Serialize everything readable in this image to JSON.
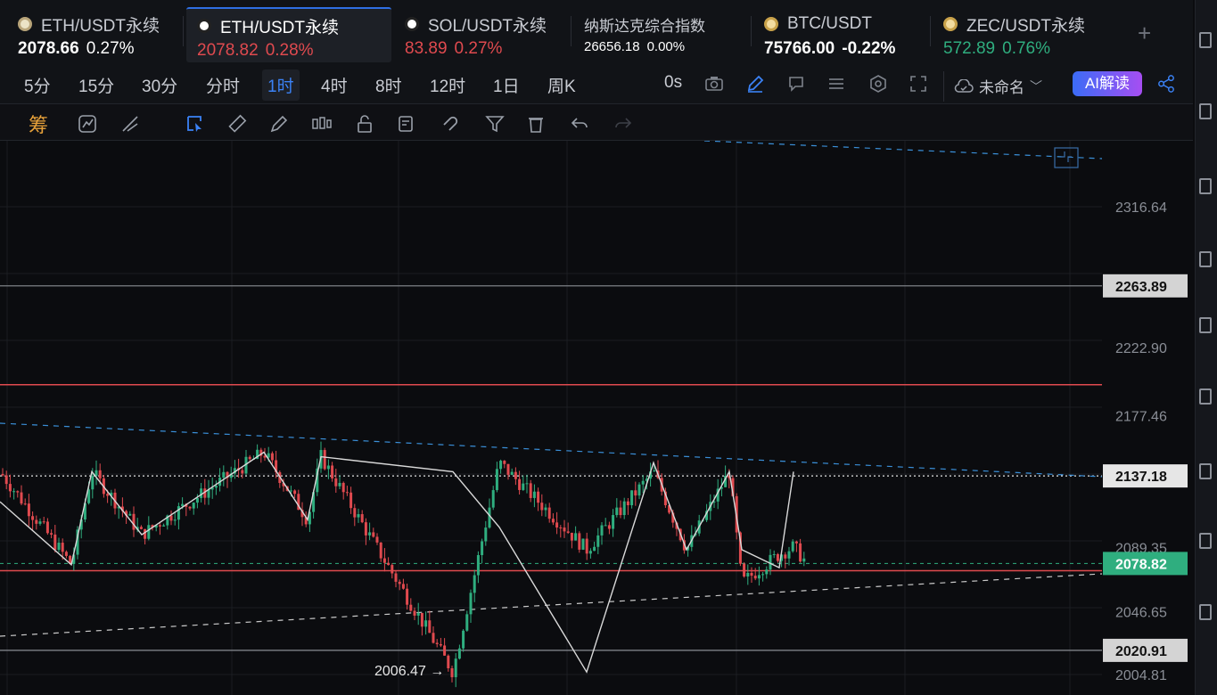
{
  "tabs": [
    {
      "name": "ETH/USDT永续",
      "price": "2078.66",
      "change": "0.27%",
      "dir": "plain",
      "icon": "eth-coin-icon"
    },
    {
      "name": "ETH/USDT永续",
      "price": "2078.82",
      "change": "0.28%",
      "dir": "up",
      "icon": "okx-logo-icon"
    },
    {
      "name": "SOL/USDT永续",
      "price": "83.89",
      "change": "0.27%",
      "dir": "up",
      "icon": "okx-logo-icon"
    },
    {
      "name": "纳斯达克综合指数",
      "price": "26656.18",
      "change": "0.00%",
      "dir": "plain",
      "icon": ""
    },
    {
      "name": "BTC/USDT",
      "price": "75766.00",
      "change": "-0.22%",
      "dir": "plain",
      "icon": "bnb-coin-icon"
    },
    {
      "name": "ZEC/USDT永续",
      "price": "572.89",
      "change": "0.76%",
      "dir": "down",
      "icon": "bnb-coin-icon"
    }
  ],
  "add_tab": "+",
  "timeframes": [
    "5分",
    "15分",
    "30分",
    "分时",
    "1时",
    "4时",
    "8时",
    "12时",
    "1日",
    "周K"
  ],
  "active_timeframe": "1时",
  "countdown": "0s",
  "layout_name": "未命名",
  "ai_button": "AI解读",
  "indicator_label": "筹",
  "price_axis": {
    "ticks": [
      "2316.64",
      "2222.90",
      "2177.46",
      "2089.35",
      "2046.65",
      "2004.81"
    ],
    "tags": {
      "line_2263": "2263.89",
      "line_2137": "2137.18",
      "current": "2078.82",
      "line_2020": "2020.91"
    }
  },
  "low_annotation": "2006.47 →",
  "colors": {
    "up": "#e04a4f",
    "down": "#2fae7f",
    "accent": "#3b82f6",
    "horizontal_red": "#e04a4f",
    "trend_dash": "#3a8fd8",
    "zigzag": "#d9d9d9"
  },
  "chart_data": {
    "type": "line",
    "title": "",
    "y_ticks": [
      2316.64,
      2222.9,
      2177.46,
      2089.35,
      2046.65,
      2004.81
    ],
    "horizontal_levels": [
      2263.89,
      2198,
      2137.18,
      2078.82,
      2074,
      2020.91
    ],
    "zigzag_points": [
      2120,
      2078,
      2140,
      2098,
      2153,
      2108,
      2150,
      2140,
      2103,
      2006.47,
      2146,
      2088,
      2140,
      2088,
      2076,
      2140,
      2086,
      2108,
      2066,
      2085
    ],
    "last_price": 2078.82,
    "low_marked": 2006.47
  }
}
